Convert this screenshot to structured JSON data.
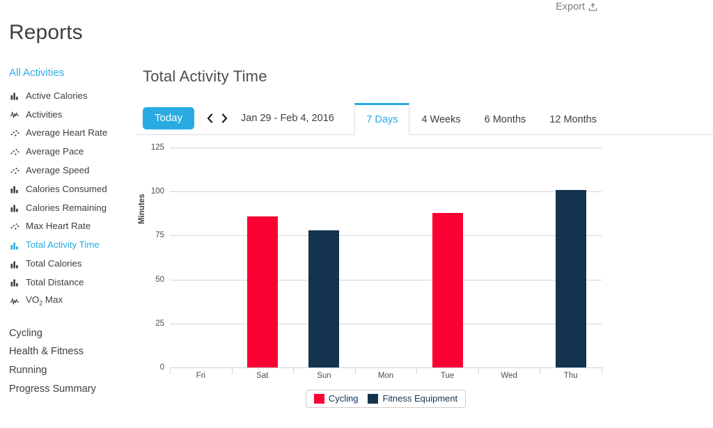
{
  "header": {
    "page_title": "Reports",
    "export_label": "Export",
    "export_icon": "export-tray-icon"
  },
  "sidebar": {
    "section_label": "All Activities",
    "metrics": [
      {
        "label": "Active Calories",
        "icon": "bar-chart-icon",
        "active": false
      },
      {
        "label": "Activities",
        "icon": "pulse-line-icon",
        "active": false
      },
      {
        "label": "Average Heart Rate",
        "icon": "scatter-icon",
        "active": false
      },
      {
        "label": "Average Pace",
        "icon": "scatter-icon",
        "active": false
      },
      {
        "label": "Average Speed",
        "icon": "scatter-icon",
        "active": false
      },
      {
        "label": "Calories Consumed",
        "icon": "bar-chart-icon",
        "active": false
      },
      {
        "label": "Calories Remaining",
        "icon": "bar-chart-icon",
        "active": false
      },
      {
        "label": "Max Heart Rate",
        "icon": "scatter-icon",
        "active": false
      },
      {
        "label": "Total Activity Time",
        "icon": "bar-chart-icon",
        "active": true
      },
      {
        "label": "Total Calories",
        "icon": "bar-chart-icon",
        "active": false
      },
      {
        "label": "Total Distance",
        "icon": "bar-chart-icon",
        "active": false
      },
      {
        "label": "VO2 Max",
        "icon": "pulse-line-icon",
        "active": false,
        "sub": "2",
        "label_pre": "VO",
        "label_post": " Max"
      }
    ],
    "groups": [
      {
        "label": "Cycling"
      },
      {
        "label": "Health & Fitness"
      },
      {
        "label": "Running"
      },
      {
        "label": "Progress Summary"
      }
    ]
  },
  "toolbar": {
    "today_label": "Today",
    "prev_icon": "chevron-left-icon",
    "next_icon": "chevron-right-icon",
    "date_range": "Jan 29 - Feb 4, 2016",
    "tabs": [
      {
        "label": "7 Days",
        "active": true
      },
      {
        "label": "4 Weeks",
        "active": false
      },
      {
        "label": "6 Months",
        "active": false
      },
      {
        "label": "12 Months",
        "active": false
      }
    ]
  },
  "colors": {
    "accent": "#29abe2",
    "cycling": "#fb0133",
    "fitness_equipment": "#13334f",
    "gridline": "#d4d4d4",
    "axis": "#c9d5dd"
  },
  "chart_data": {
    "type": "bar",
    "title": "Total Activity Time",
    "xlabel": "",
    "ylabel": "Minutes",
    "categories": [
      "Fri",
      "Sat",
      "Sun",
      "Mon",
      "Tue",
      "Wed",
      "Thu"
    ],
    "ylim": [
      0,
      125
    ],
    "yticks": [
      0,
      25,
      50,
      75,
      100,
      125
    ],
    "grid": true,
    "legend_position": "bottom",
    "series": [
      {
        "name": "Cycling",
        "color": "#fb0133",
        "values": [
          0,
          86,
          0,
          0,
          88,
          0,
          0
        ]
      },
      {
        "name": "Fitness Equipment",
        "color": "#13334f",
        "values": [
          0,
          0,
          78,
          0,
          0,
          0,
          101
        ]
      }
    ]
  }
}
